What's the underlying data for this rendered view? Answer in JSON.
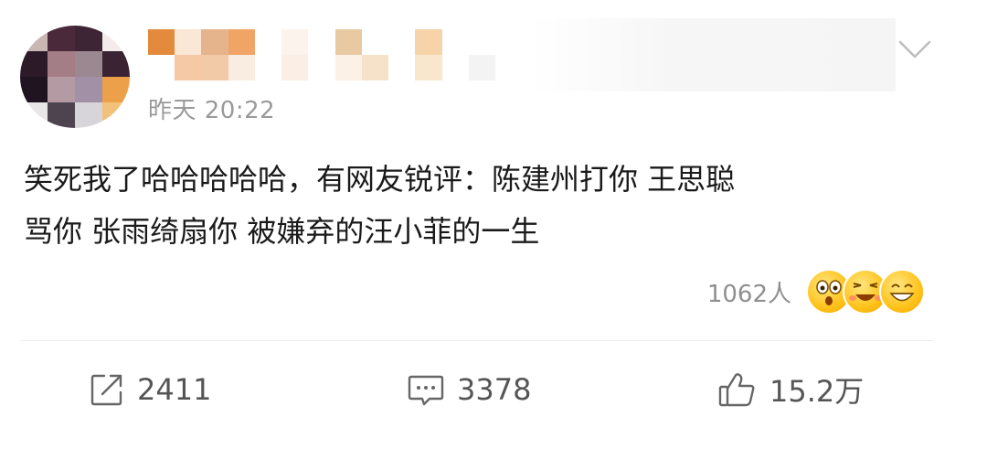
{
  "post": {
    "timestamp": "昨天 20:22",
    "content": "笑死我了哈哈哈哈哈，有网友锐评：陈建州打你 王思聪\n骂你 张雨绮扇你 被嫌弃的汪小菲的一生",
    "reactions": {
      "count": "1062人",
      "emojis": [
        "surprised-emoji-icon",
        "laughing-crying-emoji-icon",
        "grinning-emoji-icon"
      ]
    }
  },
  "actions": {
    "share_count": "2411",
    "comment_count": "3378",
    "like_count": "15.2万"
  },
  "colors": {
    "text": "#1a1a1a",
    "meta": "#9a9a9a",
    "action_text": "#555555"
  }
}
